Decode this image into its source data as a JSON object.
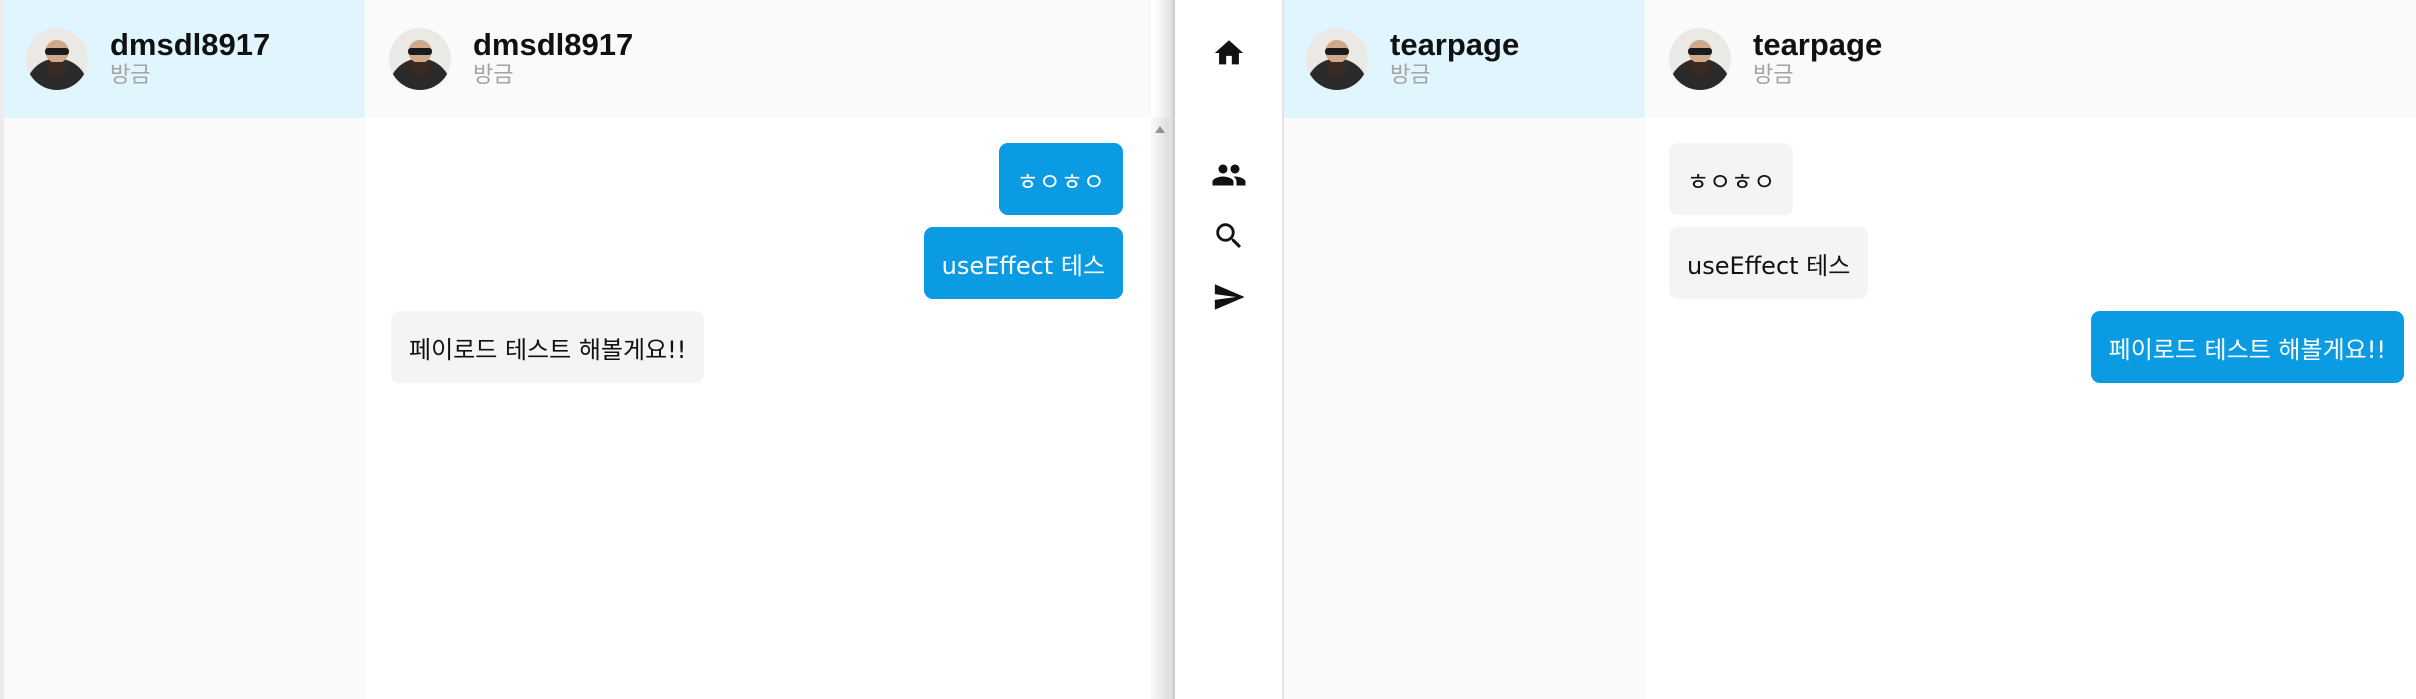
{
  "left_window": {
    "conversation": {
      "name": "dmsdl8917",
      "time": "방금"
    },
    "header": {
      "name": "dmsdl8917",
      "time": "방금"
    },
    "messages": [
      {
        "text": "ㅎㅇㅎㅇ",
        "from": "me"
      },
      {
        "text": "useEffect 테스",
        "from": "me"
      },
      {
        "text": "페이로드 테스트 해볼게요!!",
        "from": "other"
      }
    ]
  },
  "nav": {
    "items": [
      "home-icon",
      "people-icon",
      "search-icon",
      "send-icon"
    ]
  },
  "right_window": {
    "conversation": {
      "name": "tearpage",
      "time": "방금"
    },
    "header": {
      "name": "tearpage",
      "time": "방금"
    },
    "messages": [
      {
        "text": "ㅎㅇㅎㅇ",
        "from": "other"
      },
      {
        "text": "useEffect 테스",
        "from": "other"
      },
      {
        "text": "페이로드 테스트 해볼게요!!",
        "from": "me"
      }
    ]
  },
  "colors": {
    "accent": "#0a9be3",
    "selected_row": "#e0f5fe",
    "other_bubble": "#f4f4f4",
    "muted_text": "#a3a3a3"
  }
}
